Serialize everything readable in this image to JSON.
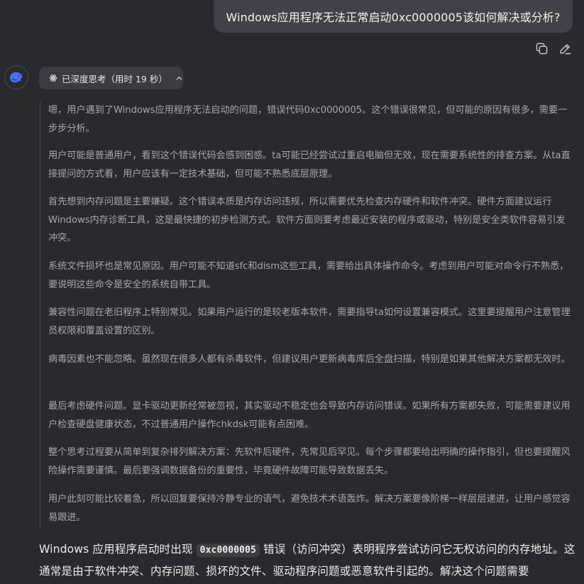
{
  "user_message": "Windows应用程序无法正常启动0xc0000005该如何解决或分析?",
  "actions": {
    "copy_icon": "copy-icon",
    "edit_icon": "edit-icon"
  },
  "assistant": {
    "avatar_icon": "deepseek-whale-icon",
    "think_label": "已深度思考（用时 19 秒）",
    "think_icon": "atom-icon",
    "collapse_icon": "chevron-up-icon",
    "thoughts": [
      "嗯，用户遇到了Windows应用程序无法启动的问题，错误代码0xc0000005。这个错误很常见，但可能的原因有很多，需要一步步分析。",
      "用户可能是普通用户，看到这个错误代码会感到困惑。ta可能已经尝试过重启电脑但无效，现在需要系统性的排查方案。从ta直接提问的方式看，用户应该有一定技术基础，但可能不熟悉底层原理。",
      "首先想到内存问题是主要嫌疑。这个错误本质是内存访问违规，所以需要优先检查内存硬件和软件冲突。硬件方面建议运行Windows内存诊断工具，这是最快捷的初步检测方式。软件方面则要考虑最近安装的程序或驱动，特别是安全类软件容易引发冲突。",
      "系统文件损坏也是常见原因。用户可能不知道sfc和dism这些工具，需要给出具体操作命令。考虑到用户可能对命令行不熟悉，要说明这些命令是安全的系统自带工具。",
      "兼容性问题在老旧程序上特别常见。如果用户运行的是较老版本软件，需要指导ta如何设置兼容模式。这里要提醒用户注意管理员权限和覆盖设置的区别。",
      "病毒因素也不能忽略。虽然现在很多人都有杀毒软件，但建议用户更新病毒库后全盘扫描，特别是如果其他解决方案都无效时。",
      "最后考虑硬件问题。显卡驱动更新经常被忽视，其实驱动不稳定也会导致内存访问错误。如果所有方案都失败，可能需要建议用户检查硬盘健康状态，不过普通用户操作chkdsk可能有点困难。",
      "整个思考过程要从简单到复杂排列解决方案：先软件后硬件，先常见后罕见。每个步骤都要给出明确的操作指引，但也要提醒风险操作需要谨慎。最后要强调数据备份的重要性，毕竟硬件故障可能导致数据丢失。",
      "用户此刻可能比较着急，所以回复要保持冷静专业的语气，避免技术术语轰炸。解决方案要像阶梯一样层层递进，让用户感觉容易跟进。"
    ],
    "answer": {
      "prefix": "Windows 应用程序启动时出现 ",
      "code": "0xc0000005",
      "suffix": " 错误（访问冲突）表明程序尝试访问它无权访问的内存地址。这通常是由于软件冲突、内存问题、损坏的文件、驱动程序问题或恶意软件引起的。解决这个问题需要"
    }
  }
}
